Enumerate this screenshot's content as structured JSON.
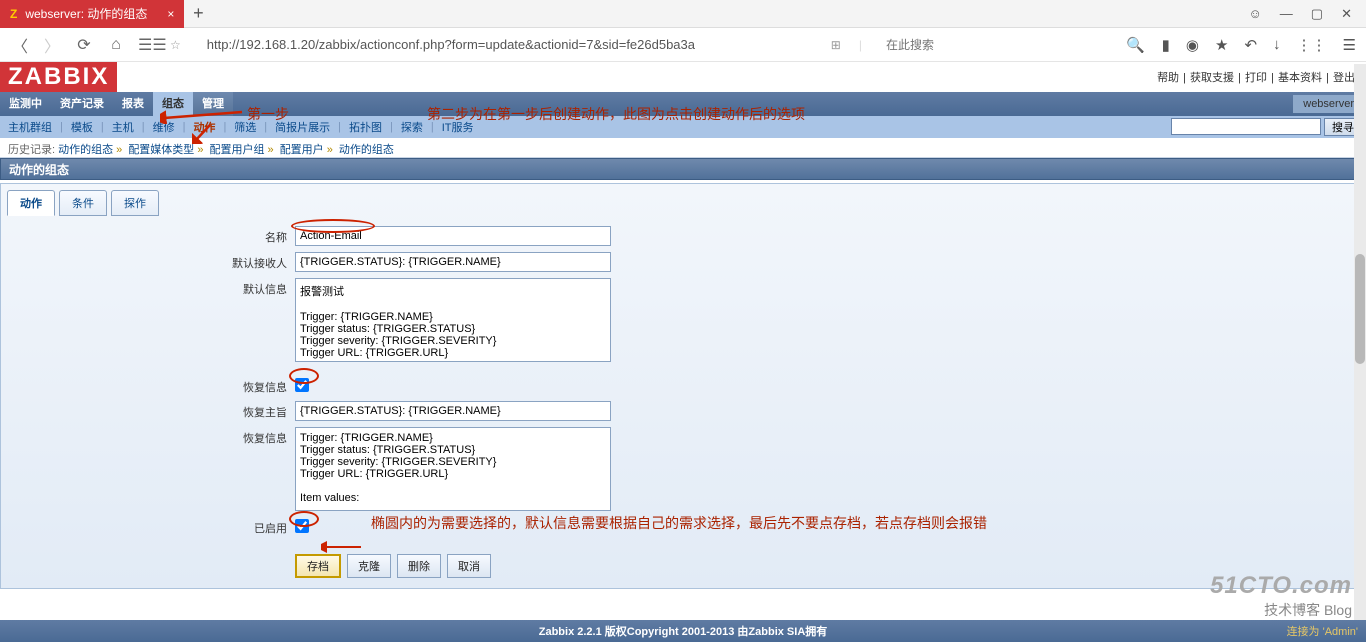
{
  "browser": {
    "tab_title": "webserver: 动作的组态",
    "url": "http://192.168.1.20/zabbix/actionconf.php?form=update&actionid=7&sid=fe26d5ba3a",
    "search_placeholder": "在此搜索"
  },
  "top_links": [
    "帮助",
    "获取支援",
    "打印",
    "基本资料",
    "登出"
  ],
  "logo": "ZABBIX",
  "main_nav": {
    "items": [
      "监测中",
      "资产记录",
      "报表",
      "组态",
      "管理"
    ],
    "active_index": 3,
    "right_label": "webserver"
  },
  "sub_nav": {
    "items": [
      "主机群组",
      "模板",
      "主机",
      "维修",
      "动作",
      "筛选",
      "简报片展示",
      "拓扑图",
      "探索",
      "IT服务"
    ],
    "active_index": 4,
    "search_button": "搜寻"
  },
  "breadcrumb": {
    "label": "历史记录:",
    "items": [
      "动作的组态",
      "配置媒体类型",
      "配置用户组",
      "配置用户",
      "动作的组态"
    ]
  },
  "section_title": "动作的组态",
  "form_tabs": [
    "动作",
    "条件",
    "探作"
  ],
  "form": {
    "name_label": "名称",
    "name_value": "Action-Email",
    "default_recipient_label": "默认接收人",
    "default_recipient_value": "{TRIGGER.STATUS}: {TRIGGER.NAME}",
    "default_msg_label": "默认信息",
    "default_msg_value": "报警测试\n\nTrigger: {TRIGGER.NAME}\nTrigger status: {TRIGGER.STATUS}\nTrigger severity: {TRIGGER.SEVERITY}\nTrigger URL: {TRIGGER.URL}",
    "recover_info_label": "恢复信息",
    "recover_subject_label": "恢复主旨",
    "recover_subject_value": "{TRIGGER.STATUS}: {TRIGGER.NAME}",
    "recover_msg_label": "恢复信息",
    "recover_msg_value": "Trigger: {TRIGGER.NAME}\nTrigger status: {TRIGGER.STATUS}\nTrigger severity: {TRIGGER.SEVERITY}\nTrigger URL: {TRIGGER.URL}\n\nItem values:",
    "enabled_label": "已启用"
  },
  "buttons": {
    "save": "存档",
    "clone": "克隆",
    "delete": "删除",
    "cancel": "取消"
  },
  "annotations": {
    "step1": "第一步",
    "step2": "第二步为在第一步后创建动作，此图为点击创建动作后的选项",
    "note": "椭圆内的为需要选择的，默认信息需要根据自己的需求选择，最后先不要点存档，若点存档则会报错"
  },
  "footer": {
    "center": "Zabbix 2.2.1 版权Copyright 2001-2013 由Zabbix SIA拥有",
    "right": "连接为 'Admin'"
  },
  "watermark": {
    "big": "51CTO.com",
    "small": "技术博客   Blog"
  }
}
